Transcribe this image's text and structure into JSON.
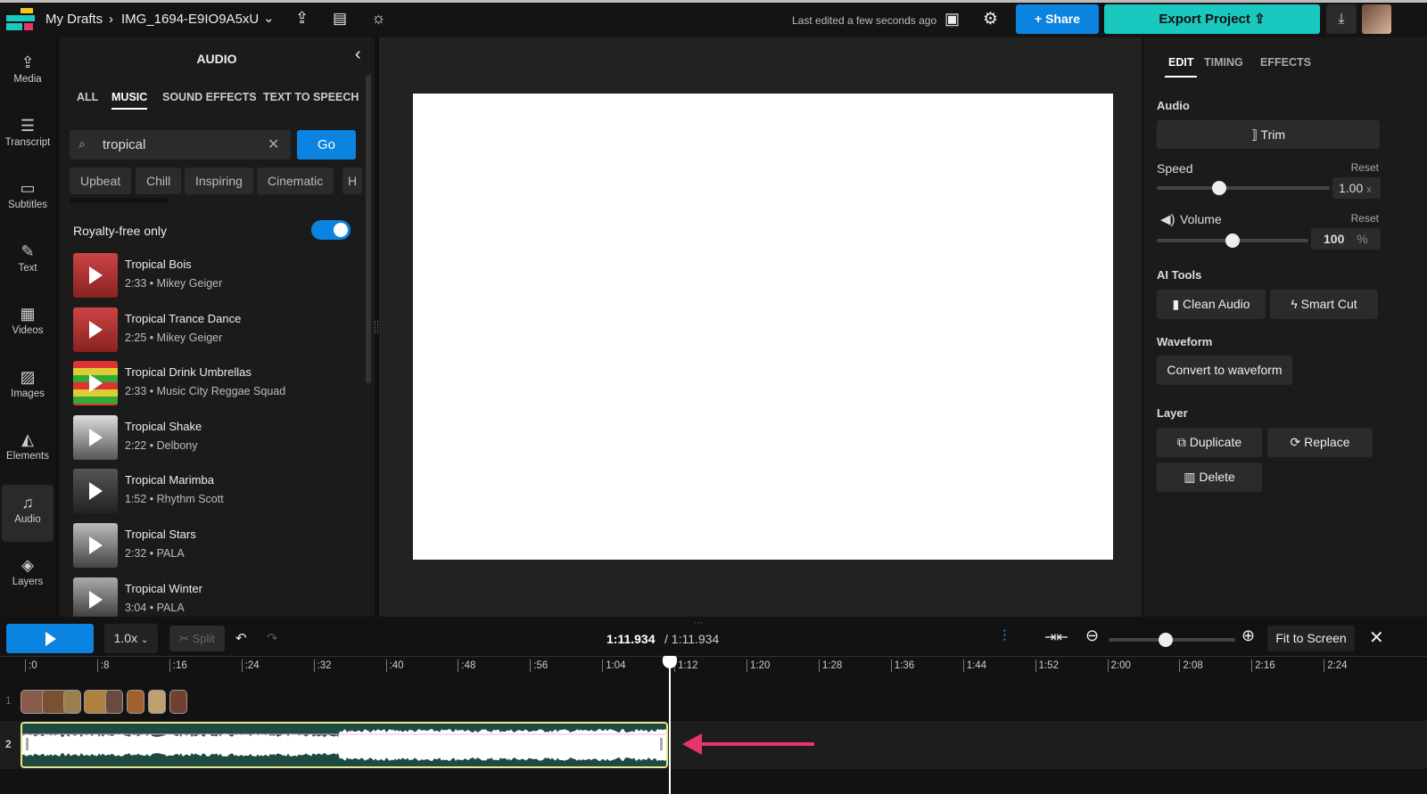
{
  "topbar": {
    "breadcrumb_root": "My Drafts",
    "separator": "›",
    "project_name": "IMG_1694-E9IO9A5xU",
    "last_edited": "Last edited a few seconds ago",
    "share_label": "Share",
    "export_label": "Export Project"
  },
  "rail": [
    {
      "label": "Media",
      "icon": "upload-cloud"
    },
    {
      "label": "Transcript",
      "icon": "transcript"
    },
    {
      "label": "Subtitles",
      "icon": "subtitles"
    },
    {
      "label": "Text",
      "icon": "edit"
    },
    {
      "label": "Videos",
      "icon": "film"
    },
    {
      "label": "Images",
      "icon": "image"
    },
    {
      "label": "Elements",
      "icon": "shapes"
    },
    {
      "label": "Audio",
      "icon": "music-note"
    },
    {
      "label": "Layers",
      "icon": "layers"
    }
  ],
  "audio_panel": {
    "title": "AUDIO",
    "tabs": [
      "ALL",
      "MUSIC",
      "SOUND EFFECTS",
      "TEXT TO SPEECH"
    ],
    "active_tab": "MUSIC",
    "search_value": "tropical",
    "go_label": "Go",
    "chips": [
      "Upbeat",
      "Chill",
      "Inspiring",
      "Cinematic",
      "H"
    ],
    "royalty_free_label": "Royalty-free only",
    "royalty_free_on": true,
    "tracks": [
      {
        "title": "Tropical Bois",
        "meta": "2:33 • Mikey Geiger"
      },
      {
        "title": "Tropical Trance Dance",
        "meta": "2:25 • Mikey Geiger"
      },
      {
        "title": "Tropical Drink Umbrellas",
        "meta": "2:33 • Music City Reggae Squad"
      },
      {
        "title": "Tropical Shake",
        "meta": "2:22 • Delbony"
      },
      {
        "title": "Tropical Marimba",
        "meta": "1:52 • Rhythm Scott"
      },
      {
        "title": "Tropical Stars",
        "meta": "2:32 • PALA"
      },
      {
        "title": "Tropical Winter",
        "meta": "3:04 • PALA"
      }
    ]
  },
  "right_panel": {
    "tabs": [
      "EDIT",
      "TIMING",
      "EFFECTS"
    ],
    "active_tab": "EDIT",
    "audio_label": "Audio",
    "trim_label": "Trim",
    "speed_label": "Speed",
    "speed_value": "1.00",
    "speed_unit": "x",
    "reset_label": "Reset",
    "volume_label": "Volume",
    "volume_value": "100",
    "volume_unit": "%",
    "ai_tools_label": "AI Tools",
    "clean_audio_label": "Clean Audio",
    "smart_cut_label": "Smart Cut",
    "waveform_label": "Waveform",
    "convert_label": "Convert to waveform",
    "layer_label": "Layer",
    "duplicate_label": "Duplicate",
    "replace_label": "Replace",
    "delete_label": "Delete"
  },
  "timeline": {
    "speed": "1.0x",
    "split_label": "Split",
    "current_time": "1:11.934",
    "total_time": "/ 1:11.934",
    "fit_label": "Fit to Screen",
    "zoom_level": 0.45,
    "ticks": [
      ":0",
      ":8",
      ":16",
      ":24",
      ":32",
      ":40",
      ":48",
      ":56",
      "1:04",
      "1:12",
      "1:20",
      "1:28",
      "1:36",
      "1:44",
      "1:52",
      "2:00",
      "2:08",
      "2:16",
      "2:24"
    ],
    "track_numbers": [
      "1",
      "2"
    ]
  },
  "colors": {
    "accent": "#0a84e0",
    "export": "#19c9c0",
    "arrow": "#e8336d",
    "wave_bg": "#1e4a44",
    "clip_border": "#e6e88a"
  }
}
